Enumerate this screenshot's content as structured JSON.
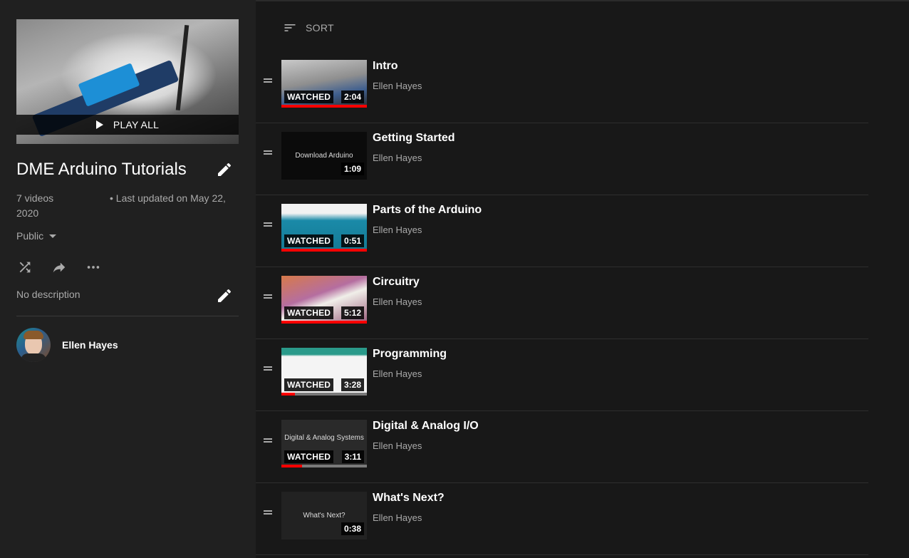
{
  "playlist": {
    "play_all_label": "PLAY ALL",
    "title": "DME Arduino Tutorials",
    "video_count": "7 videos",
    "last_updated": "• Last updated on May 22,",
    "last_updated_year": "2020",
    "privacy": "Public",
    "description": "No description",
    "owner": "Ellen Hayes"
  },
  "sort_label": "SORT",
  "watched_label": "WATCHED",
  "videos": [
    {
      "title": "Intro",
      "channel": "Ellen Hayes",
      "duration": "2:04",
      "watched": true,
      "progress": 1.0
    },
    {
      "title": "Getting Started",
      "channel": "Ellen Hayes",
      "duration": "1:09",
      "watched": false,
      "progress": 0,
      "thumb_text": "Download Arduino"
    },
    {
      "title": "Parts of the Arduino",
      "channel": "Ellen Hayes",
      "duration": "0:51",
      "watched": true,
      "progress": 1.0
    },
    {
      "title": "Circuitry",
      "channel": "Ellen Hayes",
      "duration": "5:12",
      "watched": true,
      "progress": 1.0
    },
    {
      "title": "Programming",
      "channel": "Ellen Hayes",
      "duration": "3:28",
      "watched": true,
      "progress": 0.16
    },
    {
      "title": "Digital & Analog I/O",
      "channel": "Ellen Hayes",
      "duration": "3:11",
      "watched": true,
      "progress": 0.24,
      "thumb_text": "Digital & Analog Systems"
    },
    {
      "title": "What's Next?",
      "channel": "Ellen Hayes",
      "duration": "0:38",
      "watched": false,
      "progress": 0,
      "thumb_text": "What's Next?"
    }
  ],
  "colors": {
    "progress_red": "#ff0000",
    "background": "#181818",
    "sidebar": "#202020"
  }
}
